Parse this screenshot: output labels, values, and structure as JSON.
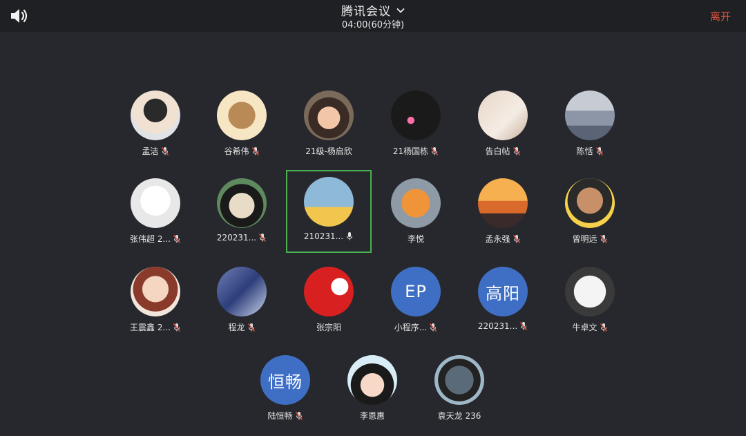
{
  "header": {
    "title": "腾讯会议",
    "timer": "04:00(60分钟)",
    "leave_label": "离开",
    "speaker_icon": "speaker-icon",
    "chevron_icon": "chevron-down-icon"
  },
  "colors": {
    "leave": "#e5533f",
    "active_border": "#4caf50",
    "initials_bg": "#3f6fc4"
  },
  "participants": [
    {
      "name": "孟洁",
      "muted": true
    },
    {
      "name": "谷希伟",
      "muted": true
    },
    {
      "name": "21级-杨启欣",
      "muted": false
    },
    {
      "name": "21杨国栋",
      "muted": true
    },
    {
      "name": "告白帖",
      "muted": true
    },
    {
      "name": "陈恬",
      "muted": true
    },
    {
      "name": "张伟超 2...",
      "muted": true
    },
    {
      "name": "220231...",
      "muted": true
    },
    {
      "name": "210231...",
      "muted": false,
      "speaking": true,
      "active": true
    },
    {
      "name": "李悦",
      "muted": false
    },
    {
      "name": "孟永强",
      "muted": true
    },
    {
      "name": "曾明远",
      "muted": true
    },
    {
      "name": "王震鑫 2...",
      "muted": true
    },
    {
      "name": "程龙",
      "muted": true
    },
    {
      "name": "张宗阳",
      "muted": false
    },
    {
      "name": "小程序...",
      "muted": true,
      "initials": "EP"
    },
    {
      "name": "220231...",
      "muted": true,
      "initials": "高阳"
    },
    {
      "name": "牛卓文",
      "muted": true
    },
    {
      "name": "陆恒畅",
      "muted": true,
      "initials": "恒畅"
    },
    {
      "name": "李恩惠",
      "muted": false
    },
    {
      "name": "袁天龙 236",
      "muted": false
    }
  ]
}
